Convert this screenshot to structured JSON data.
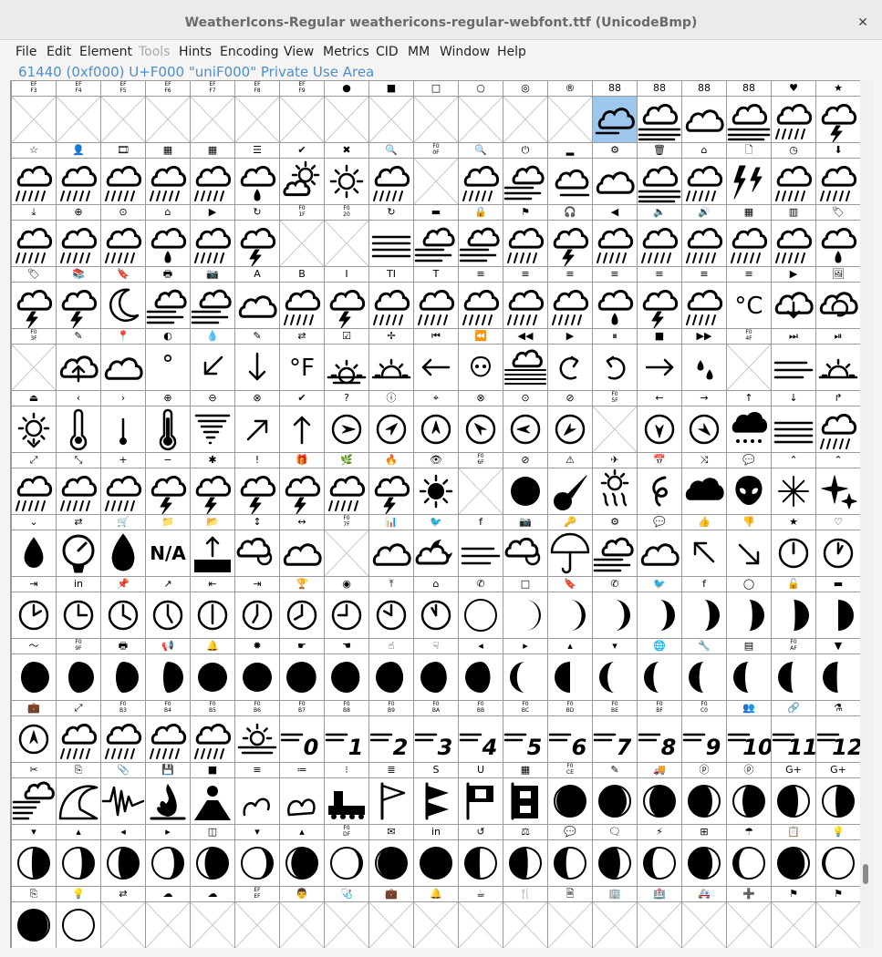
{
  "window": {
    "title": "WeatherIcons-Regular  weathericons-regular-webfont.ttf (UnicodeBmp)",
    "close_glyph": "✕"
  },
  "menu": [
    {
      "label": "File",
      "enabled": true
    },
    {
      "label": "Edit",
      "enabled": true
    },
    {
      "label": "Element",
      "enabled": true
    },
    {
      "label": "Tools",
      "enabled": false
    },
    {
      "label": "Hints",
      "enabled": true
    },
    {
      "label": "Encoding",
      "enabled": true
    },
    {
      "label": "View",
      "enabled": true
    },
    {
      "label": "Metrics",
      "enabled": true
    },
    {
      "label": "CID",
      "enabled": true
    },
    {
      "label": "MM",
      "enabled": true
    },
    {
      "label": "Window",
      "enabled": true
    },
    {
      "label": "Help",
      "enabled": true
    }
  ],
  "info_line": "61440 (0xf000) U+F000 \"uniF000\" Private Use Area",
  "grid": {
    "rows": [
      {
        "labels": [
          "EF\nF3",
          "EF\nF4",
          "EF\nF5",
          "EF\nF6",
          "EF\nF7",
          "EF\nF8",
          "EF\nF9",
          "●",
          "■",
          "□",
          "○",
          "◎",
          "®",
          "88",
          "88",
          "88",
          "88",
          "♥",
          "★"
        ],
        "glyphs": [
          "x",
          "x",
          "x",
          "x",
          "x",
          "x",
          "x",
          "x",
          "x",
          "x",
          "x",
          "x",
          "x",
          "cloud-sel",
          "cloud-fog",
          "cloud",
          "cloud-fog",
          "cloud-rain",
          "cloud-thunder"
        ]
      },
      {
        "labels": [
          "☆",
          "👤",
          "🎞",
          "▦",
          "▦",
          "☰",
          "✔",
          "✖",
          "🔍",
          "F0\n0F",
          "🔍",
          "⏻",
          "▂",
          "⚙",
          "🗑",
          "⌂",
          "🗋",
          "◷",
          "⬇"
        ],
        "glyphs": [
          "cloud-rain",
          "cloud-rain",
          "cloud-rain",
          "cloud-rain",
          "cloud-rain",
          "cloud-drop",
          "sun-cloud",
          "sun",
          "cloud-rain",
          "x",
          "cloud-rain",
          "wind-cloud",
          "cloud-wind",
          "cloud",
          "cloud-fog",
          "cloud-rain",
          "bolts",
          "cloud-rain",
          "cloud-rain"
        ]
      },
      {
        "labels": [
          "⤓",
          "⊕",
          "⊙",
          "⌂",
          "▶",
          "↻",
          "F0\n1F",
          "F0\n20",
          "↻",
          "▬",
          "🔒",
          "⚑",
          "🎧",
          "◀",
          "🔈",
          "🔊",
          "▦",
          "▥",
          "🏷"
        ],
        "glyphs": [
          "cloud-rain",
          "cloud-rain",
          "cloud-rain",
          "cloud-drop",
          "cloud-rain",
          "cloud-thunder",
          "x",
          "x",
          "fog",
          "wind-cloud",
          "wind-cloud",
          "cloud-rain",
          "cloud-thunder",
          "cloud-rain",
          "cloud-rain",
          "cloud-rain",
          "cloud-rain",
          "cloud-rain",
          "cloud-drop"
        ]
      },
      {
        "labels": [
          "🏷",
          "📚",
          "🔖",
          "🖶",
          "📷",
          "A",
          "B",
          "I",
          "TI",
          "T",
          "≡",
          "≡",
          "≡",
          "≡",
          "≡",
          "≡",
          "≡",
          "▶",
          "🖼"
        ],
        "glyphs": [
          "cloud-thunder",
          "cloud-thunder",
          "moon",
          "wind-cloud",
          "wind-cloud",
          "cloud",
          "cloud-rain",
          "cloud-thunder",
          "cloud-rain",
          "cloud-rain",
          "cloud-rain",
          "cloud-rain",
          "cloud-rain",
          "cloud-drop",
          "cloud-thunder",
          "cloud-rain",
          "celsius",
          "cloud-down",
          "cloud-refresh"
        ]
      },
      {
        "labels": [
          "F0\n3F",
          "✎",
          "📍",
          "◐",
          "💧",
          "✎",
          "⇄",
          "☑",
          "✢",
          "⏮",
          "⏪",
          "◀◀",
          "▶",
          "⏸",
          "■",
          "▶▶",
          "F0\n4F",
          "⏭",
          "⏯"
        ],
        "glyphs": [
          "x",
          "cloud-up",
          "cloud",
          "degree",
          "arrow-dl",
          "arrow-down",
          "fahrenheit",
          "sunrise",
          "sunset",
          "arrow-left",
          "alien-small",
          "fog-cloud",
          "rot-ccw",
          "rot-cw",
          "arrow-right",
          "drops",
          "x",
          "wind",
          "sunset"
        ]
      },
      {
        "labels": [
          "⏏",
          "‹",
          "›",
          "⊕",
          "⊖",
          "⊗",
          "✔",
          "?",
          "ⓘ",
          "⌖",
          "⊗",
          "⊙",
          "⊘",
          "F0\n5F",
          "←",
          "→",
          "↑",
          "↓",
          "↱"
        ],
        "glyphs": [
          "sun-set",
          "thermo",
          "thermo-low",
          "thermo-full",
          "tornado",
          "arrow-ur",
          "arrow-up",
          "compass-e",
          "compass-ne",
          "compass-n",
          "compass-nw",
          "compass-w",
          "compass-sw",
          "x",
          "compass-s",
          "compass-se",
          "hail",
          "fog",
          "cloud-rain"
        ]
      },
      {
        "labels": [
          "⤢",
          "⤡",
          "+",
          "−",
          "✱",
          "!",
          "🎁",
          "🌿",
          "🔥",
          "👁",
          "F0\n6F",
          "⊘",
          "⚠",
          "✈",
          "📅",
          "⤨",
          "💬",
          "⌃",
          "⌃"
        ],
        "glyphs": [
          "cloud-rain",
          "cloud-rain",
          "cloud-rain",
          "cloud-thunder",
          "cloud-thunder",
          "cloud-thunder",
          "cloud-thunder",
          "cloud-rain",
          "cloud-thunder",
          "sun-moon",
          "x",
          "moon-full",
          "meteor",
          "sun-haze",
          "hurricane",
          "smoke",
          "alien",
          "snowflake",
          "stars"
        ]
      },
      {
        "labels": [
          "⌄",
          "⇄",
          "🛒",
          "📁",
          "📂",
          "↕",
          "↔",
          "F0\n7F",
          "📊",
          "🐦",
          "f",
          "📷",
          "🔑",
          "⚙",
          "💬",
          "👍",
          "👎",
          "★",
          "♡"
        ],
        "glyphs": [
          "drop",
          "barometer",
          "humidity",
          "na",
          "flood",
          "cloud-sun",
          "cloud",
          "x",
          "cloud",
          "cloud-moon",
          "wind",
          "cloud-sun",
          "umbrella",
          "wind-cloud",
          "cloud",
          "arrow-ul",
          "arrow-dr",
          "clock-12",
          "clock-1"
        ]
      },
      {
        "labels": [
          "⇥",
          "in",
          "📌",
          "↗",
          "⇤",
          "⇥",
          "🏆",
          "◉",
          "⤒",
          "⌂",
          "✆",
          "□",
          "🔖",
          "✆",
          "🐦",
          "f",
          "◯",
          "🔓",
          "▬"
        ],
        "glyphs": [
          "clock-2",
          "clock-3",
          "clock-4",
          "clock-5",
          "clock-6",
          "clock-7",
          "clock-8",
          "clock-9",
          "clock-10",
          "clock-11",
          "moon-new",
          "moon-c1",
          "moon-c2",
          "moon-c3",
          "moon-c4",
          "moon-c5",
          "moon-c6",
          "moon-c7",
          "moon-q1"
        ]
      },
      {
        "labels": [
          "〜",
          "F0\n9F",
          "🖶",
          "📢",
          "🔔",
          "✹",
          "☛",
          "☚",
          "☝",
          "☟",
          "◂",
          "▸",
          "▴",
          "▾",
          "🌐",
          "🔧",
          "▤",
          "F0\nAF",
          "▼"
        ],
        "glyphs": [
          "moon-g1",
          "moon-g2",
          "moon-g3",
          "moon-g4",
          "moon-full",
          "moon-full",
          "moon-w1",
          "moon-w2",
          "moon-w3",
          "moon-w4",
          "moon-w5",
          "moon-w6",
          "moon-q3",
          "moon-w7",
          "moon-w8",
          "moon-w9",
          "moon-w10",
          "moon-w11",
          "moon-w12"
        ]
      },
      {
        "labels": [
          "💼",
          "⤢",
          "F0\nB3",
          "F0\nB4",
          "F0\nB5",
          "F0\nB6",
          "F0\nB7",
          "F0\nB8",
          "F0\nB9",
          "F0\nBA",
          "F0\nBB",
          "F0\nBC",
          "F0\nBD",
          "F0\nBE",
          "F0\nBF",
          "F0\nC0",
          "👥",
          "🔗",
          "⚗"
        ],
        "glyphs": [
          "compass-n",
          "cloud-rain",
          "cloud-rain",
          "cloud-rain",
          "cloud-rain",
          "sunrise-haze",
          "beaufort-0",
          "beaufort-1",
          "beaufort-2",
          "beaufort-3",
          "beaufort-4",
          "beaufort-5",
          "beaufort-6",
          "beaufort-7",
          "beaufort-8",
          "beaufort-9",
          "beaufort-10",
          "beaufort-11",
          "beaufort-12"
        ]
      },
      {
        "labels": [
          "✂",
          "⎘",
          "📎",
          "💾",
          "■",
          "≡",
          "≔",
          "⁝",
          "≣",
          "S",
          "U",
          "▦",
          "F0\nCE",
          "✎",
          "🚚",
          "ⓟ",
          "ⓟ",
          "G+",
          "G+"
        ],
        "glyphs": [
          "windy",
          "tsunami",
          "earthquake",
          "fire",
          "volcano",
          "gale",
          "storm-warn",
          "train",
          "flag-small",
          "flag-gale",
          "flag-storm",
          "flag-hurricane",
          "eclipse-1",
          "eclipse-2",
          "eclipse-3",
          "eclipse-4",
          "eclipse-5",
          "eclipse-6",
          "eclipse-7"
        ]
      },
      {
        "labels": [
          "▾",
          "▴",
          "◂",
          "▸",
          "◫",
          "▾",
          "▴",
          "F0\nDF",
          "✉",
          "in",
          "↺",
          "⚖",
          "💬",
          "🗨",
          "⚡",
          "⊞",
          "☂",
          "📋",
          "💡"
        ],
        "glyphs": [
          "moonph-1",
          "moonph-2",
          "moonph-3",
          "moonph-4",
          "moonph-5",
          "moonph-6",
          "moonph-7",
          "moonph-8",
          "moonph-9",
          "moonph-10",
          "moonph-11",
          "moonph-12",
          "moonph-13",
          "moonph-14",
          "moonph-15",
          "moonph-16",
          "moonph-17",
          "moonph-18",
          "moonph-19"
        ]
      },
      {
        "labels": [
          "⎘",
          "💡",
          "⇄",
          "☁",
          "☁",
          "EF\nEF",
          "👨",
          "🩺",
          "💼",
          "🔔",
          "☕",
          "🍴",
          "🗎",
          "🏢",
          "🏥",
          "🚑",
          "➕",
          "⚑",
          "⚑"
        ],
        "glyphs": [
          "moonph-20",
          "moonph-21",
          "x",
          "x",
          "x",
          "x",
          "x",
          "x",
          "x",
          "x",
          "x",
          "x",
          "x",
          "x",
          "x",
          "x",
          "x",
          "x",
          "x"
        ]
      }
    ]
  }
}
